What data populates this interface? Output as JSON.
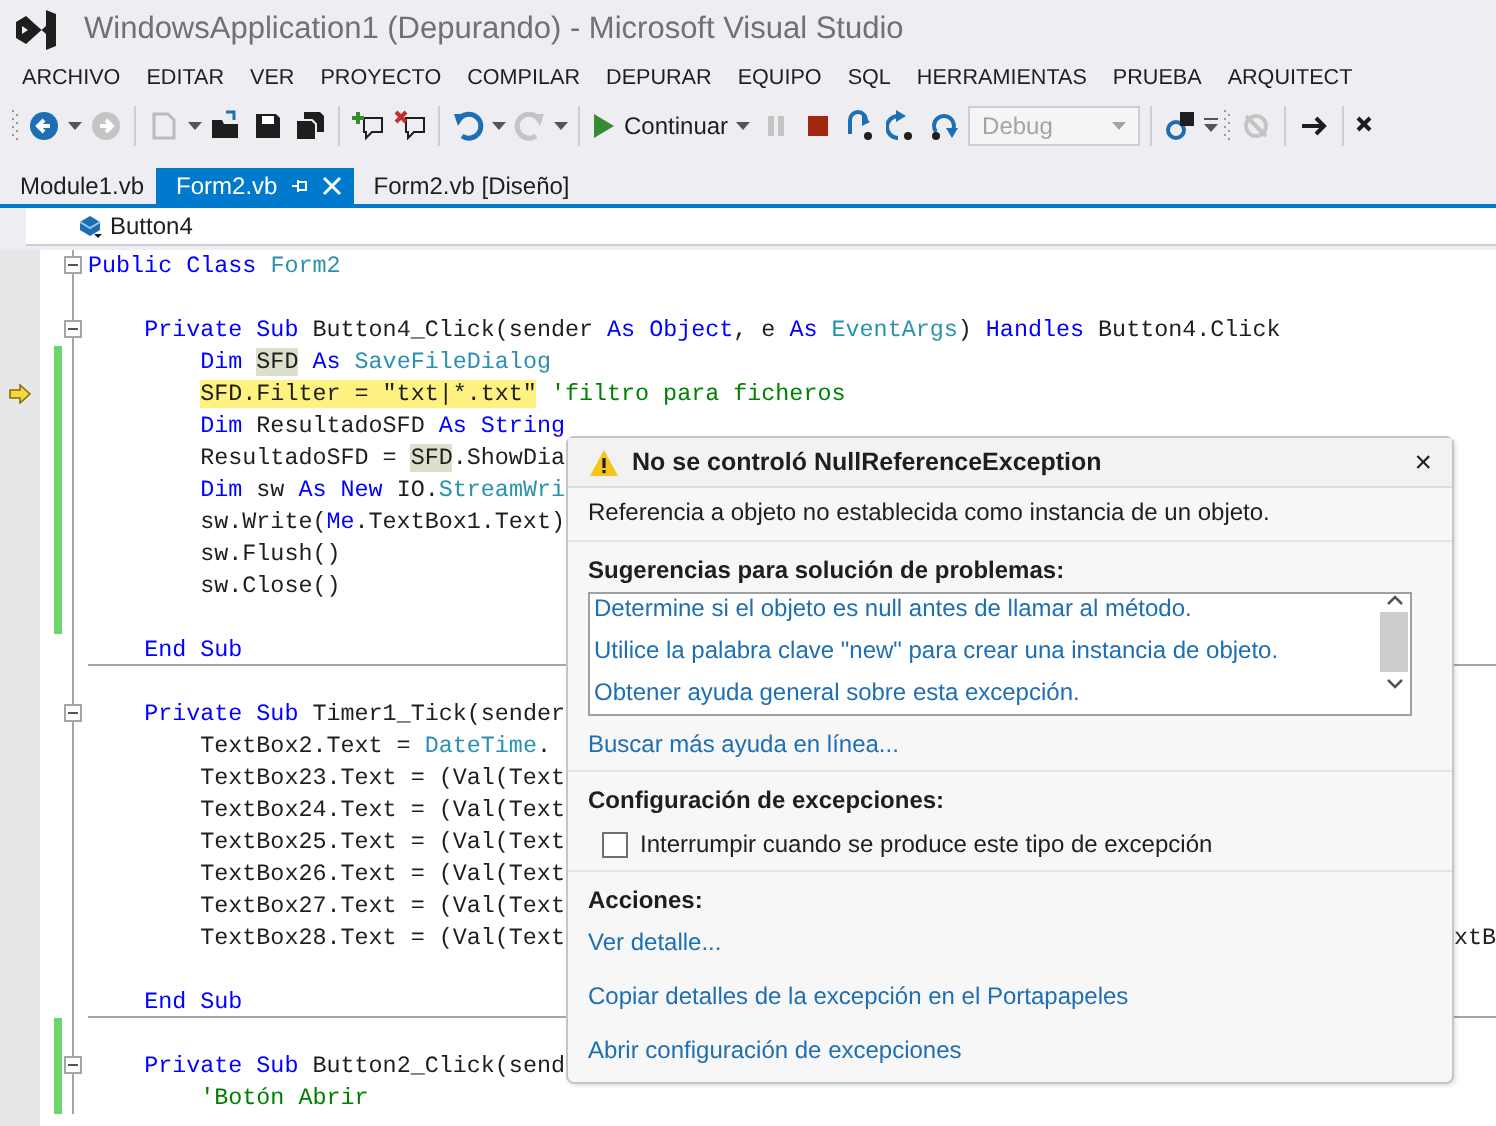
{
  "window": {
    "title": "WindowsApplication1 (Depurando) - Microsoft Visual Studio"
  },
  "menu": [
    "ARCHIVO",
    "EDITAR",
    "VER",
    "PROYECTO",
    "COMPILAR",
    "DEPURAR",
    "EQUIPO",
    "SQL",
    "HERRAMIENTAS",
    "PRUEBA",
    "ARQUITECT"
  ],
  "toolbar": {
    "continue_label": "Continuar",
    "configuration": {
      "value": "Debug",
      "disabled": true
    }
  },
  "tabs": [
    {
      "label": "Module1.vb",
      "selected": false
    },
    {
      "label": "Form2.vb",
      "selected": true
    },
    {
      "label": "Form2.vb [Diseño]",
      "selected": false
    }
  ],
  "navigation": {
    "member": "Button4"
  },
  "editor": {
    "lines": [
      {
        "fold": true,
        "changed": false,
        "current": false,
        "separator": false,
        "tokens": [
          {
            "kind": "kw",
            "text": "Public Class"
          },
          {
            "kind": "type",
            "text": " Form2"
          }
        ]
      },
      {
        "fold": false,
        "changed": false,
        "current": false,
        "separator": false
      },
      {
        "fold": true,
        "changed": false,
        "current": false,
        "separator": false,
        "tokens": [
          {
            "kind": "kw",
            "text": "    Private Sub"
          },
          {
            "kind": "plain",
            "text": " Button4_Click(sender"
          },
          {
            "kind": "kw",
            "text": " As Object"
          },
          {
            "kind": "plain",
            "text": ", e"
          },
          {
            "kind": "kw",
            "text": " As"
          },
          {
            "kind": "type",
            "text": " EventArgs"
          },
          {
            "kind": "plain",
            "text": ")"
          },
          {
            "kind": "kw",
            "text": " Handles"
          },
          {
            "kind": "plain",
            "text": " Button4.Click"
          }
        ]
      },
      {
        "fold": false,
        "changed": true,
        "current": false,
        "separator": false,
        "tokens": [
          {
            "kind": "kw",
            "text": "        Dim"
          },
          {
            "kind": "ref",
            "text": " SFD"
          },
          {
            "kind": "kw",
            "text": " As"
          },
          {
            "kind": "type",
            "text": " SaveFileDialog"
          }
        ]
      },
      {
        "fold": false,
        "changed": true,
        "current": true,
        "separator": false,
        "tokens": [
          {
            "kind": "cur",
            "text": "        SFD.Filter = \"txt|*.txt\""
          },
          {
            "kind": "cmt",
            "text": " 'filtro para ficheros"
          }
        ]
      },
      {
        "fold": false,
        "changed": true,
        "current": false,
        "separator": false,
        "tokens": [
          {
            "kind": "kw",
            "text": "        Dim"
          },
          {
            "kind": "plain",
            "text": " ResultadoSFD"
          },
          {
            "kind": "kw",
            "text": " As String"
          }
        ]
      },
      {
        "fold": false,
        "changed": true,
        "current": false,
        "separator": false,
        "tokens": [
          {
            "kind": "plain",
            "text": "        ResultadoSFD ="
          },
          {
            "kind": "ref",
            "text": " SFD"
          },
          {
            "kind": "plain",
            "text": ".ShowDia"
          }
        ]
      },
      {
        "fold": false,
        "changed": true,
        "current": false,
        "separator": false,
        "tokens": [
          {
            "kind": "kw",
            "text": "        Dim"
          },
          {
            "kind": "plain",
            "text": " sw"
          },
          {
            "kind": "kw",
            "text": " As New"
          },
          {
            "kind": "plain",
            "text": " IO."
          },
          {
            "kind": "type",
            "text": "StreamWri"
          }
        ]
      },
      {
        "fold": false,
        "changed": true,
        "current": false,
        "separator": false,
        "tokens": [
          {
            "kind": "plain",
            "text": "        sw.Write("
          },
          {
            "kind": "kw",
            "text": "Me"
          },
          {
            "kind": "plain",
            "text": ".TextBox1.Text)"
          }
        ]
      },
      {
        "fold": false,
        "changed": true,
        "current": false,
        "separator": false,
        "tokens": [
          {
            "kind": "plain",
            "text": "        sw.Flush()"
          }
        ]
      },
      {
        "fold": false,
        "changed": true,
        "current": false,
        "separator": false,
        "tokens": [
          {
            "kind": "plain",
            "text": "        sw.Close()"
          }
        ]
      },
      {
        "fold": false,
        "changed": true,
        "current": false,
        "separator": false
      },
      {
        "fold": false,
        "changed": false,
        "current": false,
        "separator": true,
        "tokens": [
          {
            "kind": "kw",
            "text": "    End Sub"
          }
        ]
      },
      {
        "fold": false,
        "changed": false,
        "current": false,
        "separator": false
      },
      {
        "fold": true,
        "changed": false,
        "current": false,
        "separator": false,
        "tokens": [
          {
            "kind": "kw",
            "text": "    Private Sub"
          },
          {
            "kind": "plain",
            "text": " Timer1_Tick(sender"
          }
        ]
      },
      {
        "fold": false,
        "changed": false,
        "current": false,
        "separator": false,
        "tokens": [
          {
            "kind": "plain",
            "text": "        TextBox2.Text ="
          },
          {
            "kind": "type",
            "text": " DateTime"
          },
          {
            "kind": "plain",
            "text": "."
          }
        ]
      },
      {
        "fold": false,
        "changed": false,
        "current": false,
        "separator": false,
        "tokens": [
          {
            "kind": "plain",
            "text": "        TextBox23.Text = (Val(Text"
          }
        ]
      },
      {
        "fold": false,
        "changed": false,
        "current": false,
        "separator": false,
        "tokens": [
          {
            "kind": "plain",
            "text": "        TextBox24.Text = (Val(Text"
          }
        ]
      },
      {
        "fold": false,
        "changed": false,
        "current": false,
        "separator": false,
        "tokens": [
          {
            "kind": "plain",
            "text": "        TextBox25.Text = (Val(Text"
          }
        ]
      },
      {
        "fold": false,
        "changed": false,
        "current": false,
        "separator": false,
        "tokens": [
          {
            "kind": "plain",
            "text": "        TextBox26.Text = (Val(Text"
          }
        ]
      },
      {
        "fold": false,
        "changed": false,
        "current": false,
        "separator": false,
        "tokens": [
          {
            "kind": "plain",
            "text": "        TextBox27.Text = (Val(Text"
          }
        ]
      },
      {
        "fold": false,
        "changed": false,
        "current": false,
        "separator": false,
        "tokens": [
          {
            "kind": "plain",
            "text": "        TextBox28.Text = (Val(Text"
          }
        ],
        "tail": "xtB"
      },
      {
        "fold": false,
        "changed": false,
        "current": false,
        "separator": false
      },
      {
        "fold": false,
        "changed": false,
        "current": false,
        "separator": true,
        "tokens": [
          {
            "kind": "kw",
            "text": "    End Sub"
          }
        ]
      },
      {
        "fold": false,
        "changed": true,
        "current": false,
        "separator": false
      },
      {
        "fold": true,
        "changed": true,
        "current": false,
        "separator": false,
        "tokens": [
          {
            "kind": "kw",
            "text": "    Private Sub"
          },
          {
            "kind": "plain",
            "text": " Button2_Click(send"
          }
        ]
      },
      {
        "fold": false,
        "changed": true,
        "current": false,
        "separator": false,
        "tokens": [
          {
            "kind": "cmt",
            "text": "        'Botón Abrir"
          }
        ]
      }
    ]
  },
  "exception": {
    "title": "No se controló NullReferenceException",
    "close_glyph": "×",
    "message": "Referencia a objeto no establecida como instancia de un objeto.",
    "suggestions_label": "Sugerencias para solución de problemas:",
    "suggestions": [
      "Determine si el objeto es null antes de llamar al método.",
      "Utilice la palabra clave \"new\" para crear una instancia de objeto.",
      "Obtener ayuda general sobre esta excepción."
    ],
    "more_help": "Buscar más ayuda en línea...",
    "settings_label": "Configuración de excepciones:",
    "break_option": {
      "label": "Interrumpir cuando se produce este tipo de excepción",
      "checked": false
    },
    "actions_label": "Acciones:",
    "actions": [
      "Ver detalle...",
      "Copiar detalles de la excepción en el Portapapeles",
      "Abrir configuración de excepciones"
    ]
  }
}
